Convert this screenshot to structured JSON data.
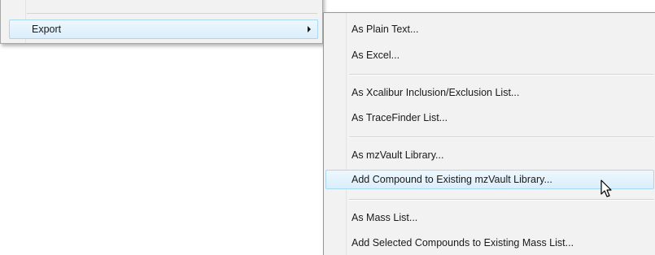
{
  "parent_menu": {
    "export_label": "Export"
  },
  "submenu": {
    "items": [
      {
        "label": "As Plain Text..."
      },
      {
        "label": "As Excel..."
      },
      {
        "label": "As Xcalibur Inclusion/Exclusion List..."
      },
      {
        "label": "As TraceFinder List..."
      },
      {
        "label": "As mzVault Library..."
      },
      {
        "label": "Add Compound to Existing mzVault Library..."
      },
      {
        "label": "As Mass List..."
      },
      {
        "label": "Add Selected Compounds to Existing Mass List..."
      }
    ],
    "hovered_item": "Add Compound to Existing mzVault Library..."
  },
  "icons": {
    "submenu_arrow": "chevron-right-icon",
    "pointer": "mouse-pointer-icon"
  },
  "colors": {
    "menu_background": "#f2f2f2",
    "highlight_border": "#a8d8f0",
    "highlight_fill": "#daeefb",
    "menu_border": "#979797"
  }
}
